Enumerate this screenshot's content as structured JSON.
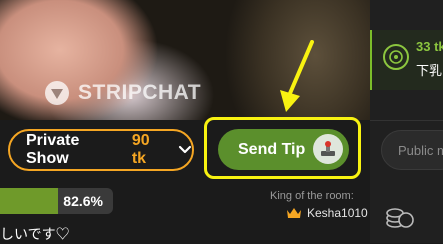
{
  "video": {
    "watermark": "STRIPCHAT"
  },
  "notification": {
    "amount_prefix": "33 tk",
    "text_prefix": "下乳"
  },
  "controls": {
    "private_show_label": "Private Show",
    "private_show_price": "90 tk",
    "send_tip_label": "Send Tip",
    "message_placeholder": "Public m"
  },
  "goal": {
    "percent_text": "82.6%",
    "progress": 0.826
  },
  "king": {
    "label": "King of the room:",
    "username": "Kesha1010"
  },
  "chat": {
    "partial_line": "しいです♡"
  },
  "colors": {
    "accent_green": "#5b8f2c",
    "private_orange": "#f5a623",
    "highlight_yellow": "#f8f211",
    "progress_green": "#6f9a2a"
  }
}
